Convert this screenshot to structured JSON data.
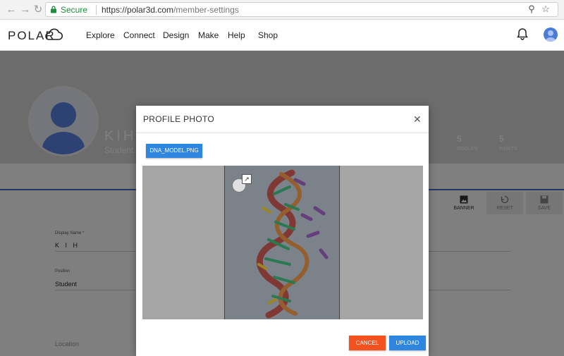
{
  "browser": {
    "secure_label": "Secure",
    "url_host": "https://polar3d.com",
    "url_path": "/member-settings"
  },
  "header": {
    "logo": "POLAR",
    "nav": [
      "Explore",
      "Connect",
      "Design",
      "Make",
      "Help",
      "Shop"
    ]
  },
  "profile": {
    "name": "KIH",
    "subtitle": "Student",
    "stats": [
      {
        "count": "5",
        "label": "GROUPS"
      },
      {
        "count": "5",
        "label": "PRINTS"
      }
    ],
    "toolbar": [
      "BANNER",
      "RESET",
      "SAVE"
    ],
    "fields": [
      {
        "label": "Display Name *",
        "value": "K I H"
      },
      {
        "label": "Position",
        "value": "Student"
      },
      {
        "label": "Location",
        "value": ""
      }
    ]
  },
  "modal": {
    "title": "PROFILE PHOTO",
    "file_button": "DNA_MODEL.PNG",
    "cancel_label": "CANCEL",
    "upload_label": "UPLOAD"
  },
  "colors": {
    "primary": "#2e86de",
    "cancel": "#f4511e",
    "accent_line": "#3f6fd2"
  }
}
